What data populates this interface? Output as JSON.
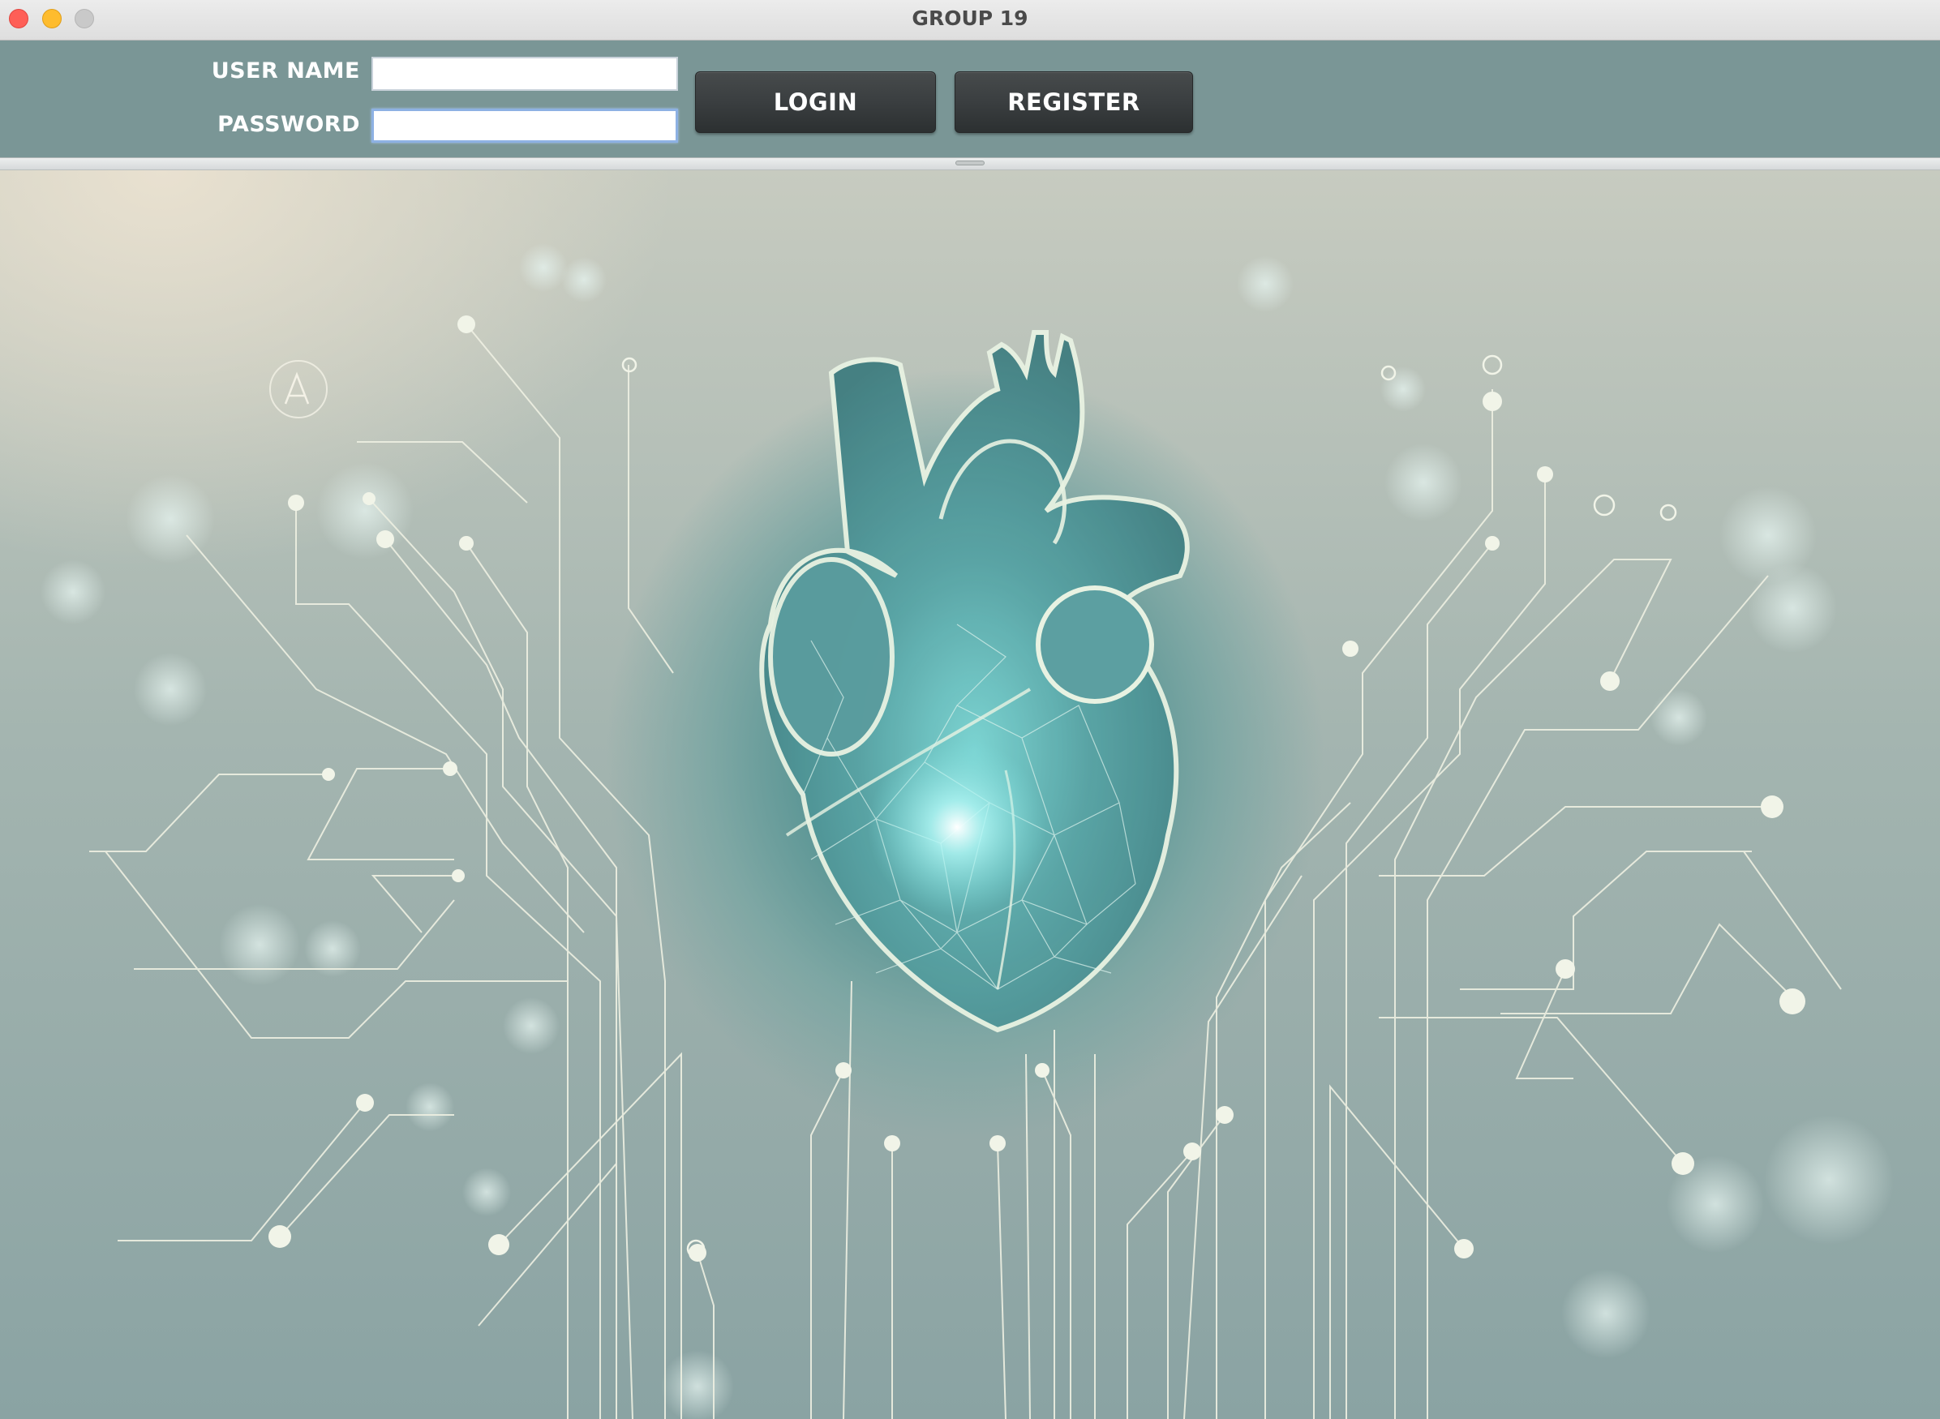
{
  "window": {
    "title": "GROUP 19"
  },
  "login_form": {
    "username_label": "USER NAME",
    "username_value": "",
    "password_label": "PASSWORD",
    "password_value": "",
    "login_button": "LOGIN",
    "register_button": "REGISTER"
  },
  "background": {
    "image": "heart-circuit-illustration",
    "accent_color": "#4f9090",
    "toolbar_color": "#7a9696"
  }
}
